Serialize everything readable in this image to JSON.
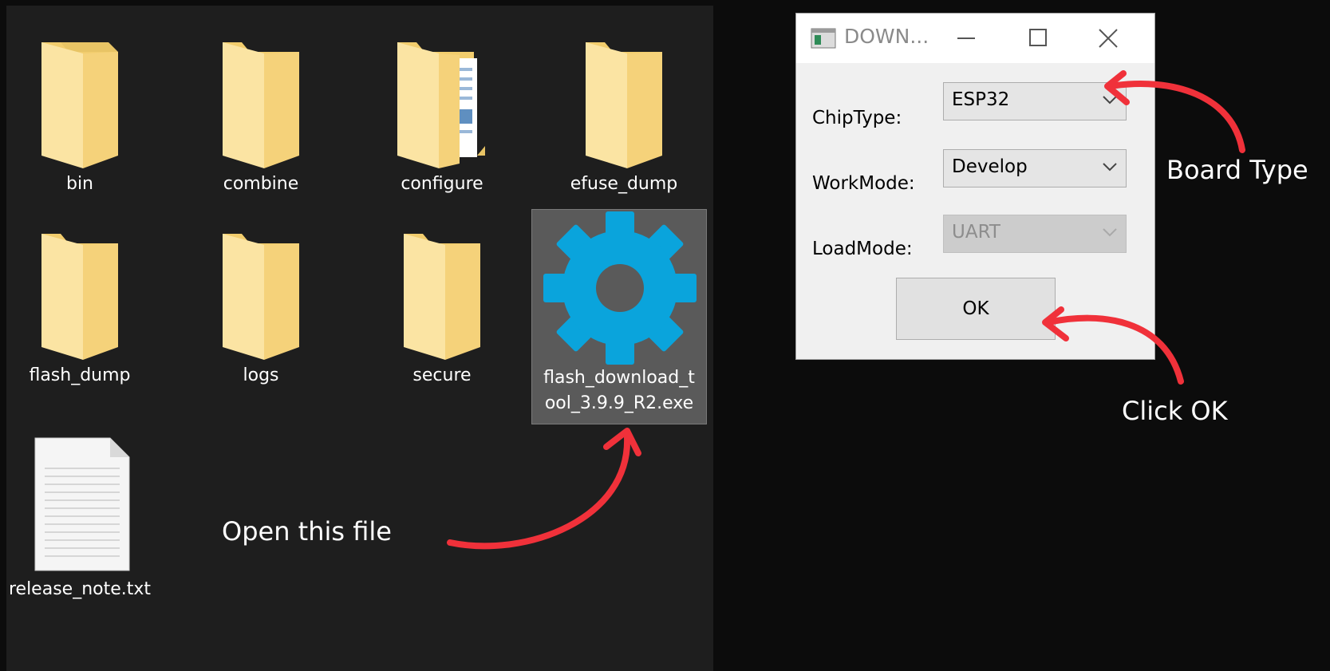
{
  "explorer": {
    "items": [
      {
        "label": "bin",
        "type": "folder"
      },
      {
        "label": "combine",
        "type": "folder"
      },
      {
        "label": "configure",
        "type": "folder-with-files"
      },
      {
        "label": "efuse_dump",
        "type": "folder"
      },
      {
        "label": "flash_dump",
        "type": "folder"
      },
      {
        "label": "logs",
        "type": "folder"
      },
      {
        "label": "secure",
        "type": "folder"
      },
      {
        "label_line1": "flash_download_t",
        "label_line2": "ool_3.9.9_R2.exe",
        "type": "exe-gear",
        "selected": true
      },
      {
        "label": "release_note.txt",
        "type": "text-file"
      }
    ]
  },
  "dialog": {
    "title": "DOWN...",
    "chip_type": {
      "label": "ChipType:",
      "value": "ESP32"
    },
    "work_mode": {
      "label": "WorkMode:",
      "value": "Develop"
    },
    "load_mode": {
      "label": "LoadMode:",
      "value": "UART",
      "disabled": true
    },
    "ok_label": "OK"
  },
  "annotations": {
    "open_file": "Open this file",
    "board_type": "Board Type",
    "click_ok": "Click OK"
  },
  "colors": {
    "folder": "#f7d57a",
    "gear": "#0aa4dc",
    "arrow": "#f0313a",
    "explorer_bg": "#1e1e1e"
  }
}
